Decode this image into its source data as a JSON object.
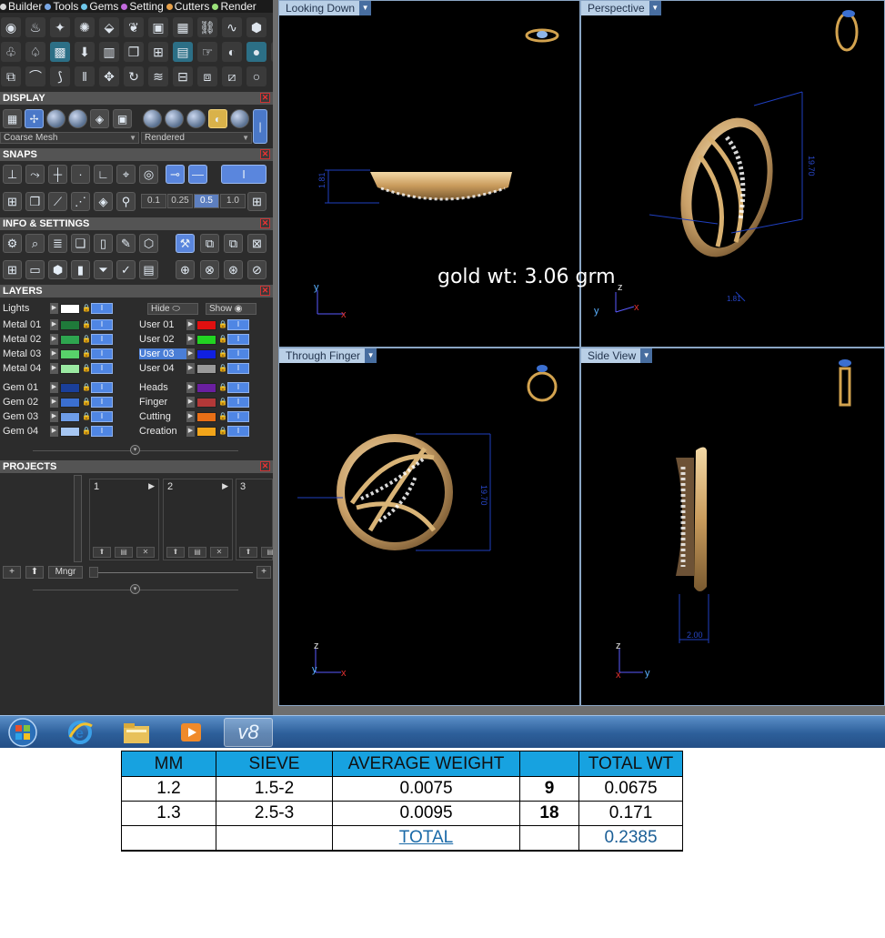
{
  "menubar": {
    "items": [
      {
        "label": "Builder",
        "color": "#d8d8d8"
      },
      {
        "label": "Tools",
        "color": "#7aa8e6"
      },
      {
        "label": "Gems",
        "color": "#6fc7e9"
      },
      {
        "label": "Setting",
        "color": "#c26adc"
      },
      {
        "label": "Cutters",
        "color": "#e7a14b"
      },
      {
        "label": "Render",
        "color": "#9be27a"
      }
    ]
  },
  "sections": {
    "display": "DISPLAY",
    "snaps": "SNAPS",
    "info": "INFO & SETTINGS",
    "layers": "LAYERS",
    "projects": "PROJECTS"
  },
  "display": {
    "mesh_option": "Coarse Mesh",
    "render_option": "Rendered"
  },
  "snaps": {
    "tolerances": [
      "0.1",
      "0.25",
      "0.5",
      "1.0"
    ],
    "active_tolerance": "0.5"
  },
  "layers": {
    "lights_label": "Lights",
    "lights_color": "#ffffff",
    "hide_label": "Hide",
    "show_label": "Show",
    "left": [
      {
        "name": "Metal 01",
        "color": "#1f7a3a"
      },
      {
        "name": "Metal 02",
        "color": "#2ea44f"
      },
      {
        "name": "Metal 03",
        "color": "#58d16a"
      },
      {
        "name": "Metal 04",
        "color": "#9be9a2"
      },
      {
        "name": "Gem 01",
        "color": "#1a3f9a"
      },
      {
        "name": "Gem 02",
        "color": "#3b6fd0"
      },
      {
        "name": "Gem 03",
        "color": "#6e9de8"
      },
      {
        "name": "Gem 04",
        "color": "#a6c6f2"
      }
    ],
    "right": [
      {
        "name": "User 01",
        "color": "#e01010"
      },
      {
        "name": "User 02",
        "color": "#22d322"
      },
      {
        "name": "User 03",
        "color": "#1020e0"
      },
      {
        "name": "User 04",
        "color": "#9a9a9a"
      },
      {
        "name": "Heads",
        "color": "#6a1fa0"
      },
      {
        "name": "Finger",
        "color": "#b23838"
      },
      {
        "name": "Cutting",
        "color": "#e86f16"
      },
      {
        "name": "Creation",
        "color": "#f2a51a"
      }
    ],
    "highlighted": "User 03"
  },
  "projects": {
    "slots": [
      "1",
      "2",
      "3"
    ],
    "manager_label": "Mngr"
  },
  "viewports": {
    "top_left": "Looking Down",
    "top_right": "Perspective",
    "bottom_left": "Through Finger",
    "bottom_right": "Side View",
    "axes": {
      "x": "x",
      "y": "y",
      "z": "z"
    },
    "dims": {
      "looking_down_height": "1.81",
      "perspective_width": "19.70",
      "perspective_depth": "1.81",
      "through_finger_height": "19.70",
      "side_view_width": "2.00"
    }
  },
  "overlay": {
    "gold_weight": "gold wt: 3.06 grm"
  },
  "taskbar": {
    "active_app_label": "v8"
  },
  "weight_table": {
    "headers": [
      "MM",
      "SIEVE",
      "AVERAGE WEIGHT",
      "",
      "TOTAL WT"
    ],
    "rows": [
      [
        "1.2",
        "1.5-2",
        "0.0075",
        "9",
        "0.0675"
      ],
      [
        "1.3",
        "2.5-3",
        "0.0095",
        "18",
        "0.171"
      ]
    ],
    "total_label": "TOTAL",
    "total_value": "0.2385"
  }
}
